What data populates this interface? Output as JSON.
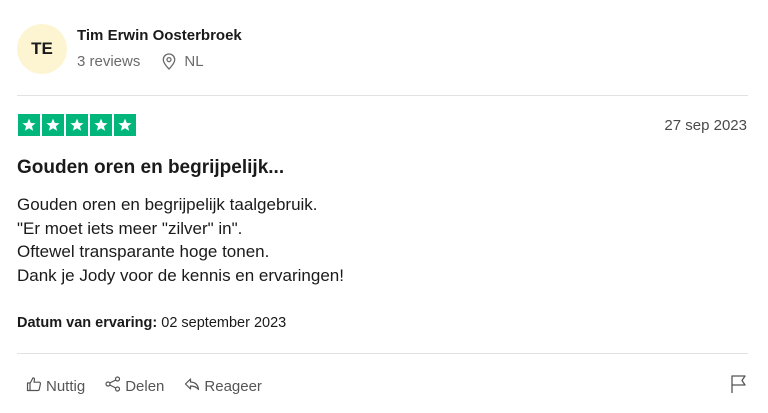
{
  "reviewer": {
    "initials": "TE",
    "name": "Tim Erwin Oosterbroek",
    "reviews_count": "3 reviews",
    "location": "NL"
  },
  "review": {
    "rating": 5,
    "star_color": "#00b67a",
    "date": "27 sep 2023",
    "title": "Gouden oren en begrijpelijk...",
    "body_lines": [
      "Gouden oren en begrijpelijk taalgebruik.",
      "\"Er moet iets meer \"zilver\" in\".",
      "Oftewel transparante hoge tonen.",
      "Dank je Jody voor de kennis en ervaringen!"
    ],
    "experience_label": "Datum van ervaring:",
    "experience_date": "02 september 2023"
  },
  "actions": {
    "useful": "Nuttig",
    "share": "Delen",
    "reply": "Reageer"
  },
  "icons": {
    "location": "location-pin-icon",
    "useful": "thumbs-up-icon",
    "share": "share-icon",
    "reply": "reply-icon",
    "report": "flag-icon"
  }
}
